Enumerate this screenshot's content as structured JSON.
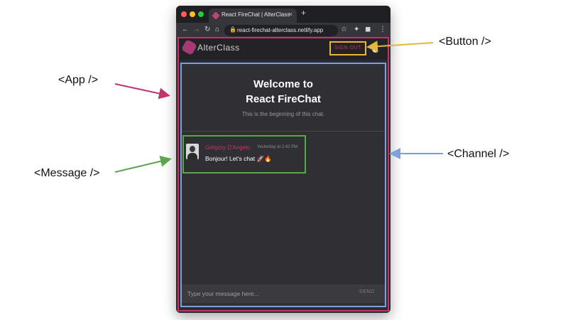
{
  "browser": {
    "tab_title": "React FireChat | AlterClass",
    "tab_close": "×",
    "new_tab": "+",
    "url": "react-firechat-alterclass.netlify.app",
    "nav": {
      "back": "←",
      "forward": "→",
      "reload": "↻",
      "home": "⌂",
      "star": "☆",
      "puzzle": "✦",
      "menu": "⋮"
    }
  },
  "app": {
    "brand": "AlterClass",
    "sign_out_label": "SIGN OUT",
    "welcome_title_line1": "Welcome to",
    "welcome_title_line2": "React FireChat",
    "welcome_subtitle": "This is the beginning of this chat.",
    "message": {
      "author": "Grégory D'Angelo",
      "timestamp": "Yesterday at 2:42 PM",
      "text": "Bonjour! Let's chat 🚀🔥"
    },
    "composer": {
      "placeholder": "Type your message here...",
      "send_label": "SEND"
    }
  },
  "annotations": {
    "app": "<App />",
    "button": "<Button />",
    "channel": "<Channel />",
    "message": "<Message />"
  },
  "colors": {
    "app": "#c0336b",
    "button": "#e5b73b",
    "channel": "#7fa0d9",
    "message": "#5aa64b"
  }
}
